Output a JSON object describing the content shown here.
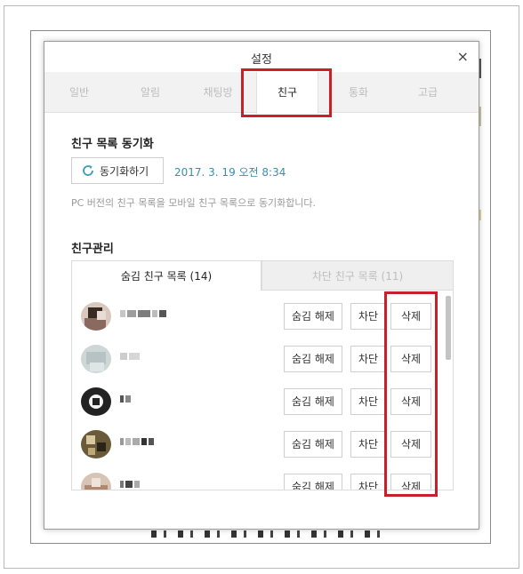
{
  "dialog": {
    "title": "설정",
    "close_glyph": "×"
  },
  "tabs": [
    {
      "label": "일반",
      "active": false
    },
    {
      "label": "알림",
      "active": false
    },
    {
      "label": "채팅방",
      "active": false
    },
    {
      "label": "친구",
      "active": true
    },
    {
      "label": "통화",
      "active": false
    },
    {
      "label": "고급",
      "active": false
    }
  ],
  "sync_section": {
    "title": "친구 목록 동기화",
    "button_label": "동기화하기",
    "button_icon": "refresh-icon",
    "last_sync": "2017. 3. 19 오전 8:34",
    "description": "PC 버전의 친구 목록을 모바일 친구 목록으로 동기화합니다."
  },
  "manage_section": {
    "title": "친구관리",
    "tab_hidden": "숨김 친구 목록 (14)",
    "tab_blocked": "차단 친구 목록 (11)"
  },
  "row_buttons": {
    "unhide": "숨김 해제",
    "block": "차단",
    "delete": "삭제"
  },
  "friends": [
    {
      "name": "",
      "avatar": "blurred-photo"
    },
    {
      "name": "",
      "avatar": "blurred-photo"
    },
    {
      "name": "",
      "avatar": "blurred-photo"
    },
    {
      "name": "",
      "avatar": "blurred-photo"
    },
    {
      "name": "",
      "avatar": "blurred-photo"
    }
  ],
  "colors": {
    "highlight": "#c8202a",
    "sync_date": "#3b8fa8"
  }
}
